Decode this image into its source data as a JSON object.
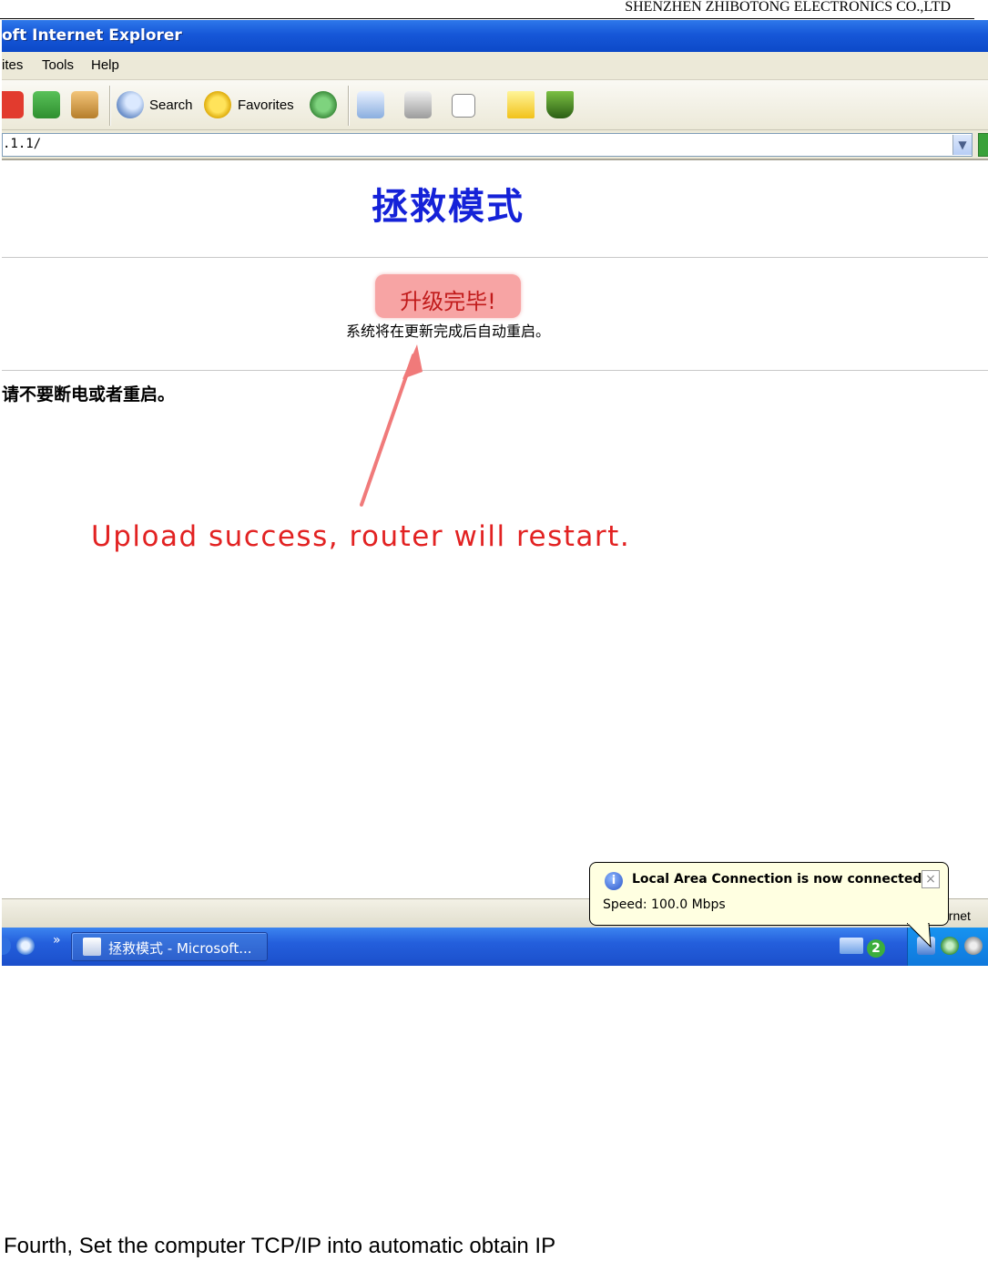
{
  "document": {
    "company_header": "SHENZHEN ZHIBOTONG ELECTRONICS CO.,LTD",
    "caption": "Fourth, Set the computer TCP/IP into automatic obtain IP"
  },
  "browser": {
    "title": "oft Internet Explorer",
    "menu": [
      "ites",
      "Tools",
      "Help"
    ],
    "toolbar": {
      "search_label": "Search",
      "favorites_label": "Favorites"
    },
    "address": ".1.1/"
  },
  "page": {
    "heading": "拯救模式",
    "status_badge": "升级完毕!",
    "sub_note": "系统将在更新完成后自动重启。",
    "warning": "请不要断电或者重启。",
    "annotation": "Upload success, router will restart."
  },
  "statusbar": {
    "zone_text": "ernet"
  },
  "taskbar": {
    "window_button": "拯救模式 - Microsoft...",
    "quick_chevron": "»",
    "tray_badge": "2"
  },
  "notification": {
    "title": "Local Area Connection is now connected",
    "body": "Speed: 100.0 Mbps",
    "close": "×",
    "icon": "info-icon"
  },
  "colors": {
    "heading_blue": "#1522d8",
    "annotation_red": "#e22222",
    "badge_pink": "#f7a4a4",
    "xp_blue": "#245fdc"
  }
}
